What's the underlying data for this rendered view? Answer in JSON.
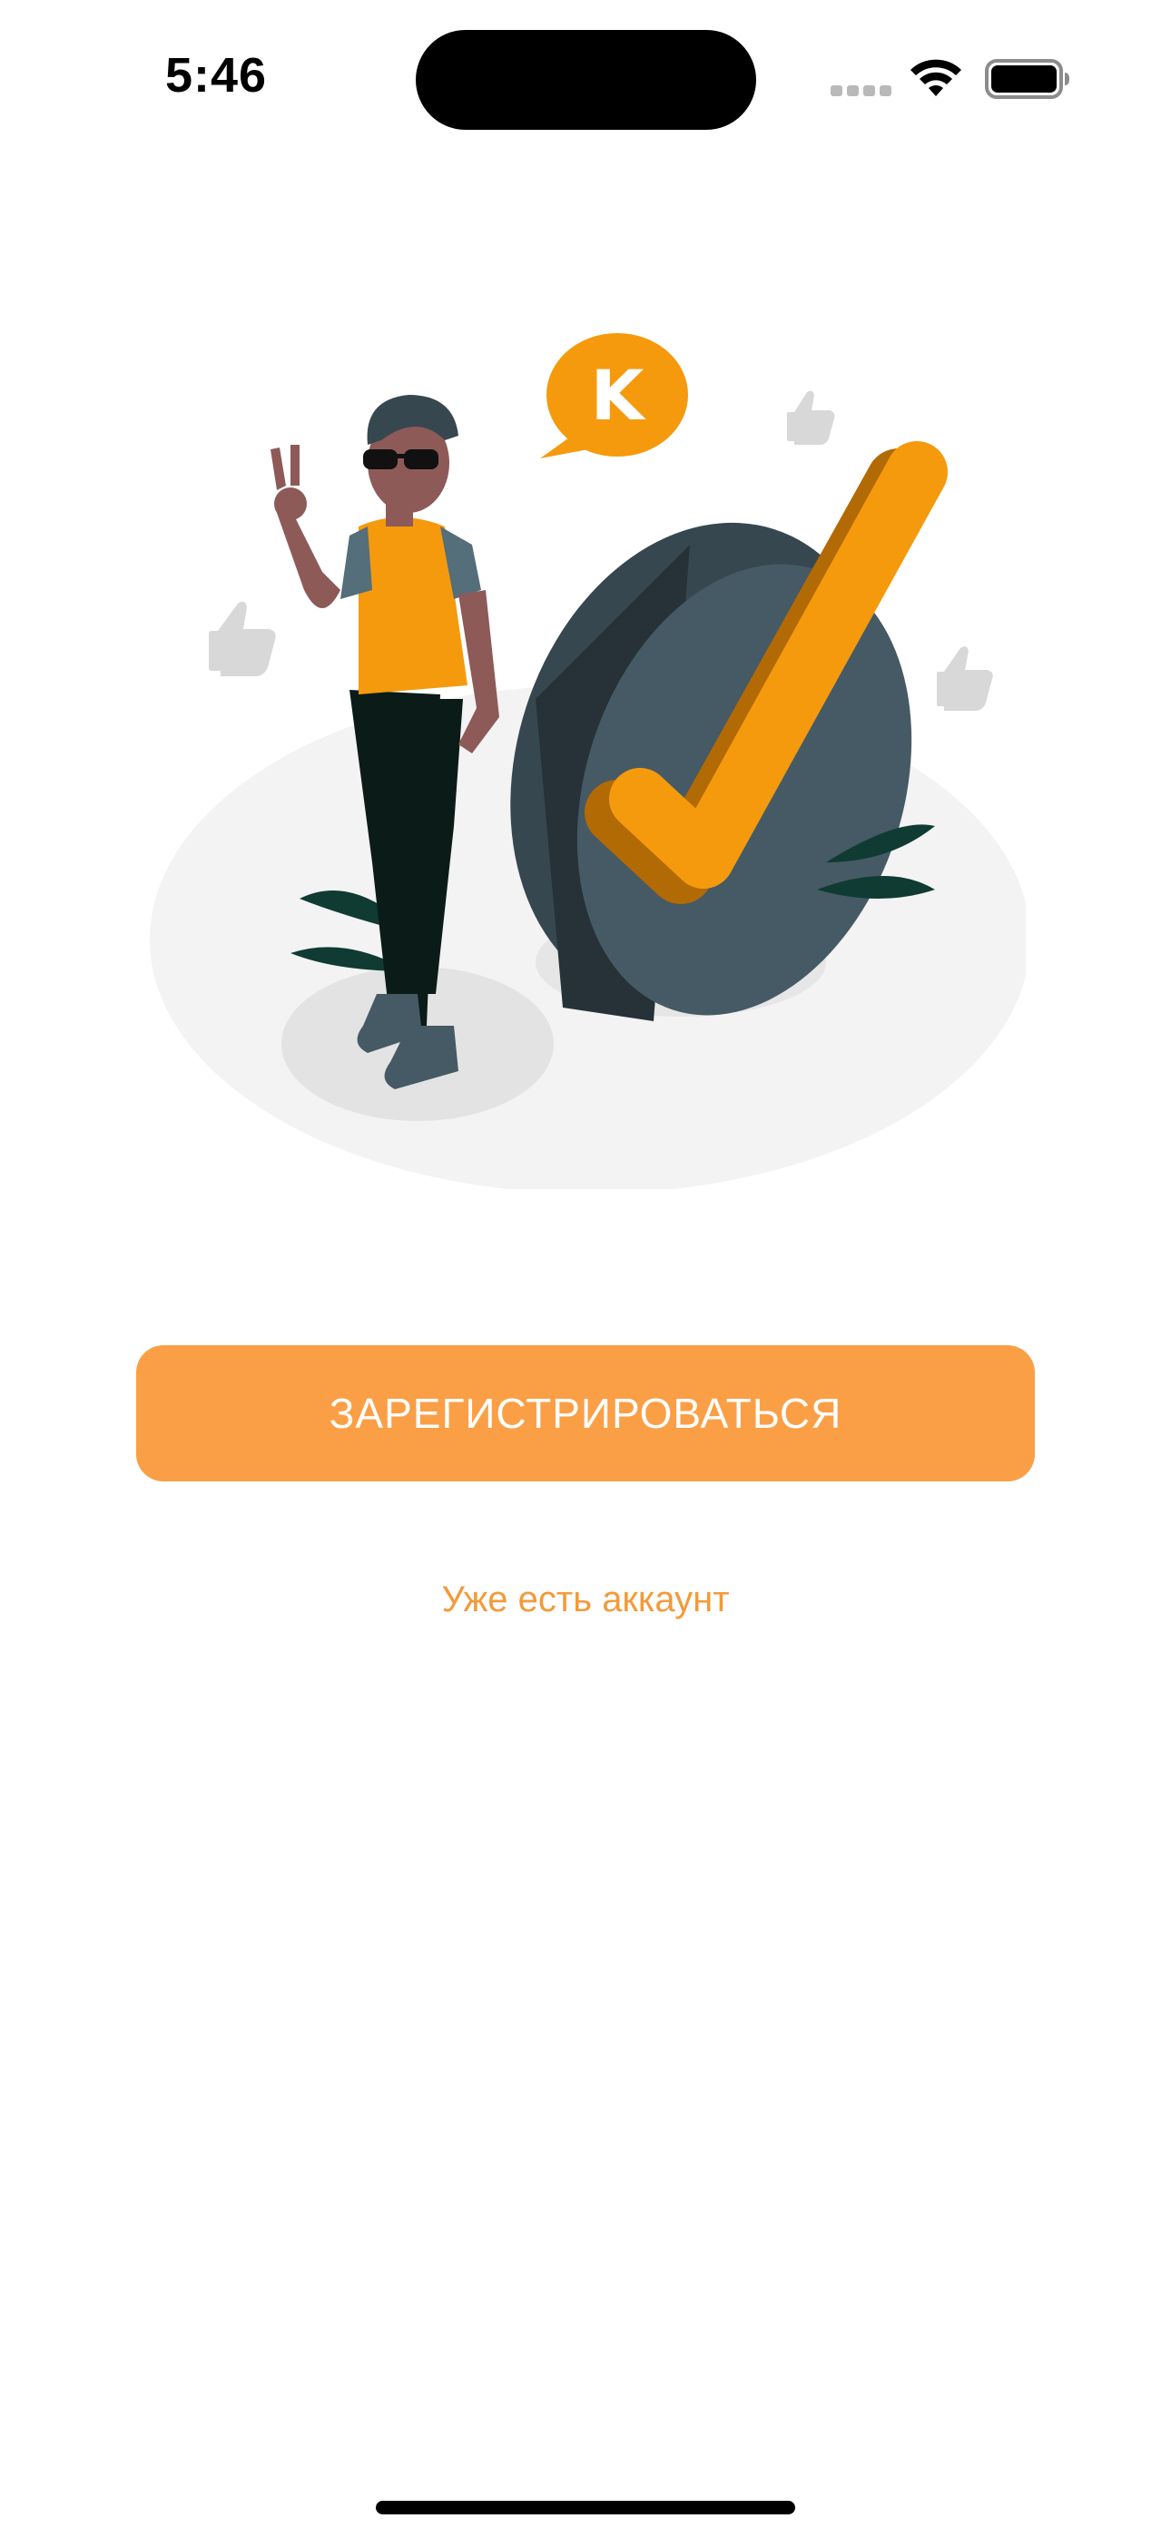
{
  "status_bar": {
    "time": "5:46",
    "signal_icon": "cellular-signal-icon",
    "wifi_icon": "wifi-icon",
    "battery_icon": "battery-icon"
  },
  "illustration": {
    "speech_bubble_letter": "K",
    "icons": [
      "person-illustration",
      "checkmark-illustration",
      "speech-bubble-icon",
      "thumbs-up-icon",
      "plant-icon"
    ]
  },
  "actions": {
    "register_label": "ЗАРЕГИСТРИРОВАТЬСЯ",
    "login_label": "Уже есть аккаунт"
  },
  "colors": {
    "accent": "#fb9f46",
    "link": "#f39a3a",
    "illustration_orange": "#f59a0c",
    "illustration_dark": "#455a64"
  }
}
